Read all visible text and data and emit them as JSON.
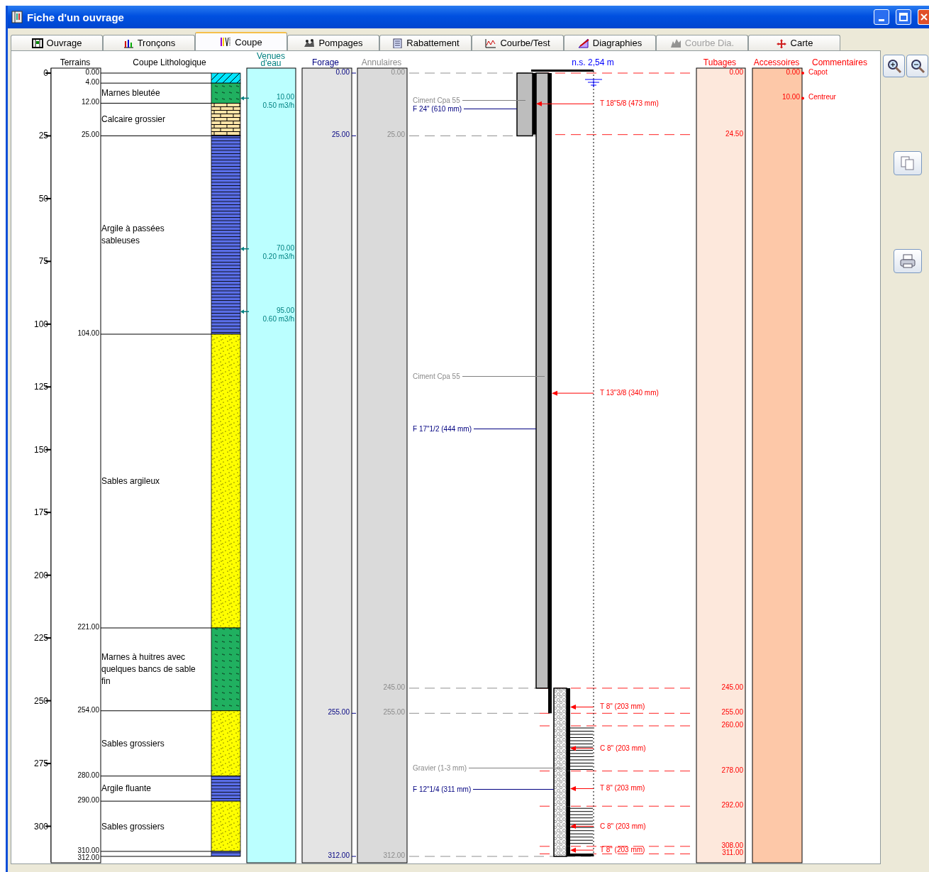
{
  "window": {
    "title": "Fiche d'un ouvrage"
  },
  "tabs": [
    {
      "label": "Ouvrage",
      "selected": false,
      "disabled": false
    },
    {
      "label": "Tronçons",
      "selected": false,
      "disabled": false
    },
    {
      "label": "Coupe",
      "selected": true,
      "disabled": false
    },
    {
      "label": "Pompages",
      "selected": false,
      "disabled": false
    },
    {
      "label": "Rabattement",
      "selected": false,
      "disabled": false
    },
    {
      "label": "Courbe/Test",
      "selected": false,
      "disabled": false
    },
    {
      "label": "Diagraphies",
      "selected": false,
      "disabled": false
    },
    {
      "label": "Courbe Dia.",
      "selected": false,
      "disabled": true
    },
    {
      "label": "Carte",
      "selected": false,
      "disabled": false
    }
  ],
  "depth_axis": {
    "ticks": [
      "0",
      "25",
      "50",
      "75",
      "100",
      "125",
      "150",
      "175",
      "200",
      "225",
      "250",
      "275",
      "300"
    ]
  },
  "terrains": {
    "header": "Terrains",
    "depth_marks": [
      "0.00",
      "4.00",
      "12.00",
      "25.00",
      "104.00",
      "221.00",
      "254.00",
      "280.00",
      "290.00",
      "310.00",
      "312.00"
    ]
  },
  "lithology": {
    "header": "Coupe Lithologique",
    "layers": [
      {
        "kind": "topsoil"
      },
      {
        "kind": "marl",
        "label": "Marnes bleutée"
      },
      {
        "kind": "limestone",
        "label": "Calcaire grossier"
      },
      {
        "kind": "clay",
        "label": "Argile à passées sableuses"
      },
      {
        "kind": "sand",
        "label": "Sables argileux"
      },
      {
        "kind": "marl",
        "label": "Marnes à huitres avec quelques bancs de sable fin"
      },
      {
        "kind": "sand",
        "label": "Sables grossiers"
      },
      {
        "kind": "clay",
        "label": "Argile fluante"
      },
      {
        "kind": "sand",
        "label": "Sables grossiers"
      },
      {
        "kind": "clay"
      }
    ]
  },
  "water_inflows": {
    "header": "Venues d'eau",
    "items": [
      {
        "depth": "10.00",
        "flow": "0.50 m3/h"
      },
      {
        "depth": "70.00",
        "flow": "0.20 m3/h"
      },
      {
        "depth": "95.00",
        "flow": "0.60 m3/h"
      }
    ]
  },
  "forage": {
    "header": "Forage",
    "depth_marks": [
      "0.00",
      "25.00",
      "255.00",
      "312.00"
    ],
    "sections": [
      {
        "label": "F 24\" (610 mm)"
      },
      {
        "label": "F 17\"1/2 (444 mm)"
      },
      {
        "label": "F 12\"1/4 (311 mm)"
      }
    ]
  },
  "annulaires": {
    "header": "Annulaires",
    "depth_marks": [
      "0.00",
      "25.00",
      "245.00",
      "255.00",
      "312.00"
    ],
    "materials": [
      {
        "kind": "cement",
        "label": "Ciment Cpa 55"
      },
      {
        "kind": "cement",
        "label": "Ciment Cpa 55"
      },
      {
        "kind": "gravel",
        "label": "Gravier (1-3 mm)"
      }
    ]
  },
  "water_level": {
    "label": "n.s. 2,54 m"
  },
  "tubages": {
    "header": "Tubages",
    "depth_marks": [
      "0.00",
      "24.50",
      "245.00",
      "255.00",
      "260.00",
      "278.00",
      "292.00",
      "308.00",
      "311.00"
    ],
    "strings": [
      {
        "segments": [
          {
            "kind": "tube",
            "label": "T 18\"5/8 (473 mm)"
          }
        ]
      },
      {
        "segments": [
          {
            "kind": "tube",
            "label": "T 13\"3/8 (340 mm)"
          }
        ]
      },
      {
        "segments": [
          {
            "kind": "tube",
            "label": "T 8\" (203 mm)"
          },
          {
            "kind": "screen",
            "label": "C 8\" (203 mm)"
          },
          {
            "kind": "tube",
            "label": "T 8\" (203 mm)"
          },
          {
            "kind": "screen",
            "label": "C 8\" (203 mm)"
          },
          {
            "kind": "tube",
            "label": "T 8\" (203 mm)"
          }
        ]
      }
    ]
  },
  "accessoires": {
    "header": "Accessoires",
    "comments_header": "Commentaires",
    "items": [
      {
        "depth": "0.00",
        "comment": "Capot"
      },
      {
        "depth": "10.00",
        "comment": "Centreur"
      }
    ]
  }
}
